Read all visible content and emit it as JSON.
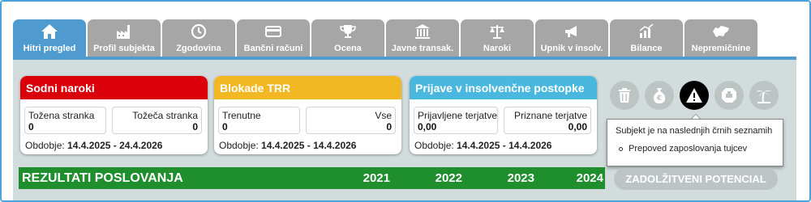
{
  "tabs": [
    {
      "label": "Hitri pregled",
      "icon": "home-icon",
      "active": true
    },
    {
      "label": "Profil subjekta",
      "icon": "factory-icon",
      "active": false
    },
    {
      "label": "Zgodovina",
      "icon": "history-icon",
      "active": false
    },
    {
      "label": "Bančni računi",
      "icon": "bank-card-icon",
      "active": false
    },
    {
      "label": "Ocena",
      "icon": "trophy-icon",
      "active": false
    },
    {
      "label": "Javne transak.",
      "icon": "institution-icon",
      "active": false
    },
    {
      "label": "Naroki",
      "icon": "scales-icon",
      "active": false
    },
    {
      "label": "Upnik v insolv.",
      "icon": "megaphone-icon",
      "active": false
    },
    {
      "label": "Bilance",
      "icon": "bar-chart-icon",
      "active": false
    },
    {
      "label": "Nepremičnine",
      "icon": "slovenia-map-icon",
      "active": false
    }
  ],
  "cards": {
    "sodni": {
      "title": "Sodni naroki",
      "color": "#d9000c",
      "left_label": "Tožena stranka",
      "left_value": "0",
      "right_label": "Tožeča stranka",
      "right_value": "0",
      "period_label": "Obdobje:",
      "period_value": "14.4.2025 - 24.4.2026"
    },
    "blokade": {
      "title": "Blokade TRR",
      "color": "#f1b823",
      "left_label": "Trenutne",
      "left_value": "0",
      "right_label": "Vse",
      "right_value": "0",
      "period_label": "Obdobje:",
      "period_value": "14.4.2025 - 14.4.2026"
    },
    "prijave": {
      "title": "Prijave v insolvenčne postopke",
      "color": "#4ab7de",
      "left_label": "Prijavljene terjatve",
      "left_value": "0,00",
      "right_label": "Priznane terjatve",
      "right_value": "0,00",
      "period_label": "Obdobje:",
      "period_value": "14.4.2025 - 14.4.2026"
    }
  },
  "status_icons": [
    "trash-icon",
    "money-bag-icon",
    "warning-icon",
    "badge-icon",
    "palm-tree-icon"
  ],
  "tooltip": {
    "title": "Subjekt je na naslednjih črnih seznamih",
    "items": [
      "Prepoved zaposlovanja tujcev"
    ]
  },
  "results": {
    "title": "REZULTATI POSLOVANJA",
    "years": [
      "2021",
      "2022",
      "2023",
      "2024"
    ],
    "color": "#1f8f2e"
  },
  "potential_button": "ZADOLŽITVENI POTENCIAL"
}
